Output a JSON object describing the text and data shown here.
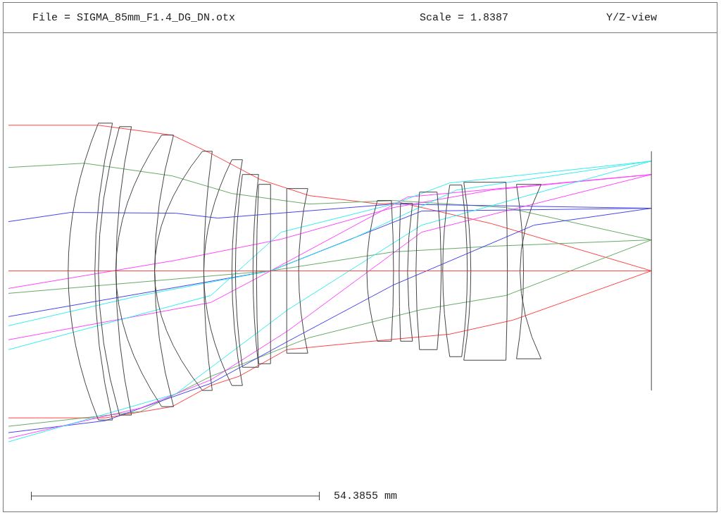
{
  "header": {
    "file": "File = SIGMA_85mm_F1.4_DG_DN.otx",
    "scale": "Scale = 1.8387",
    "view": "Y/Z-view"
  },
  "scale_bar": {
    "label": "54.3855 mm"
  }
}
